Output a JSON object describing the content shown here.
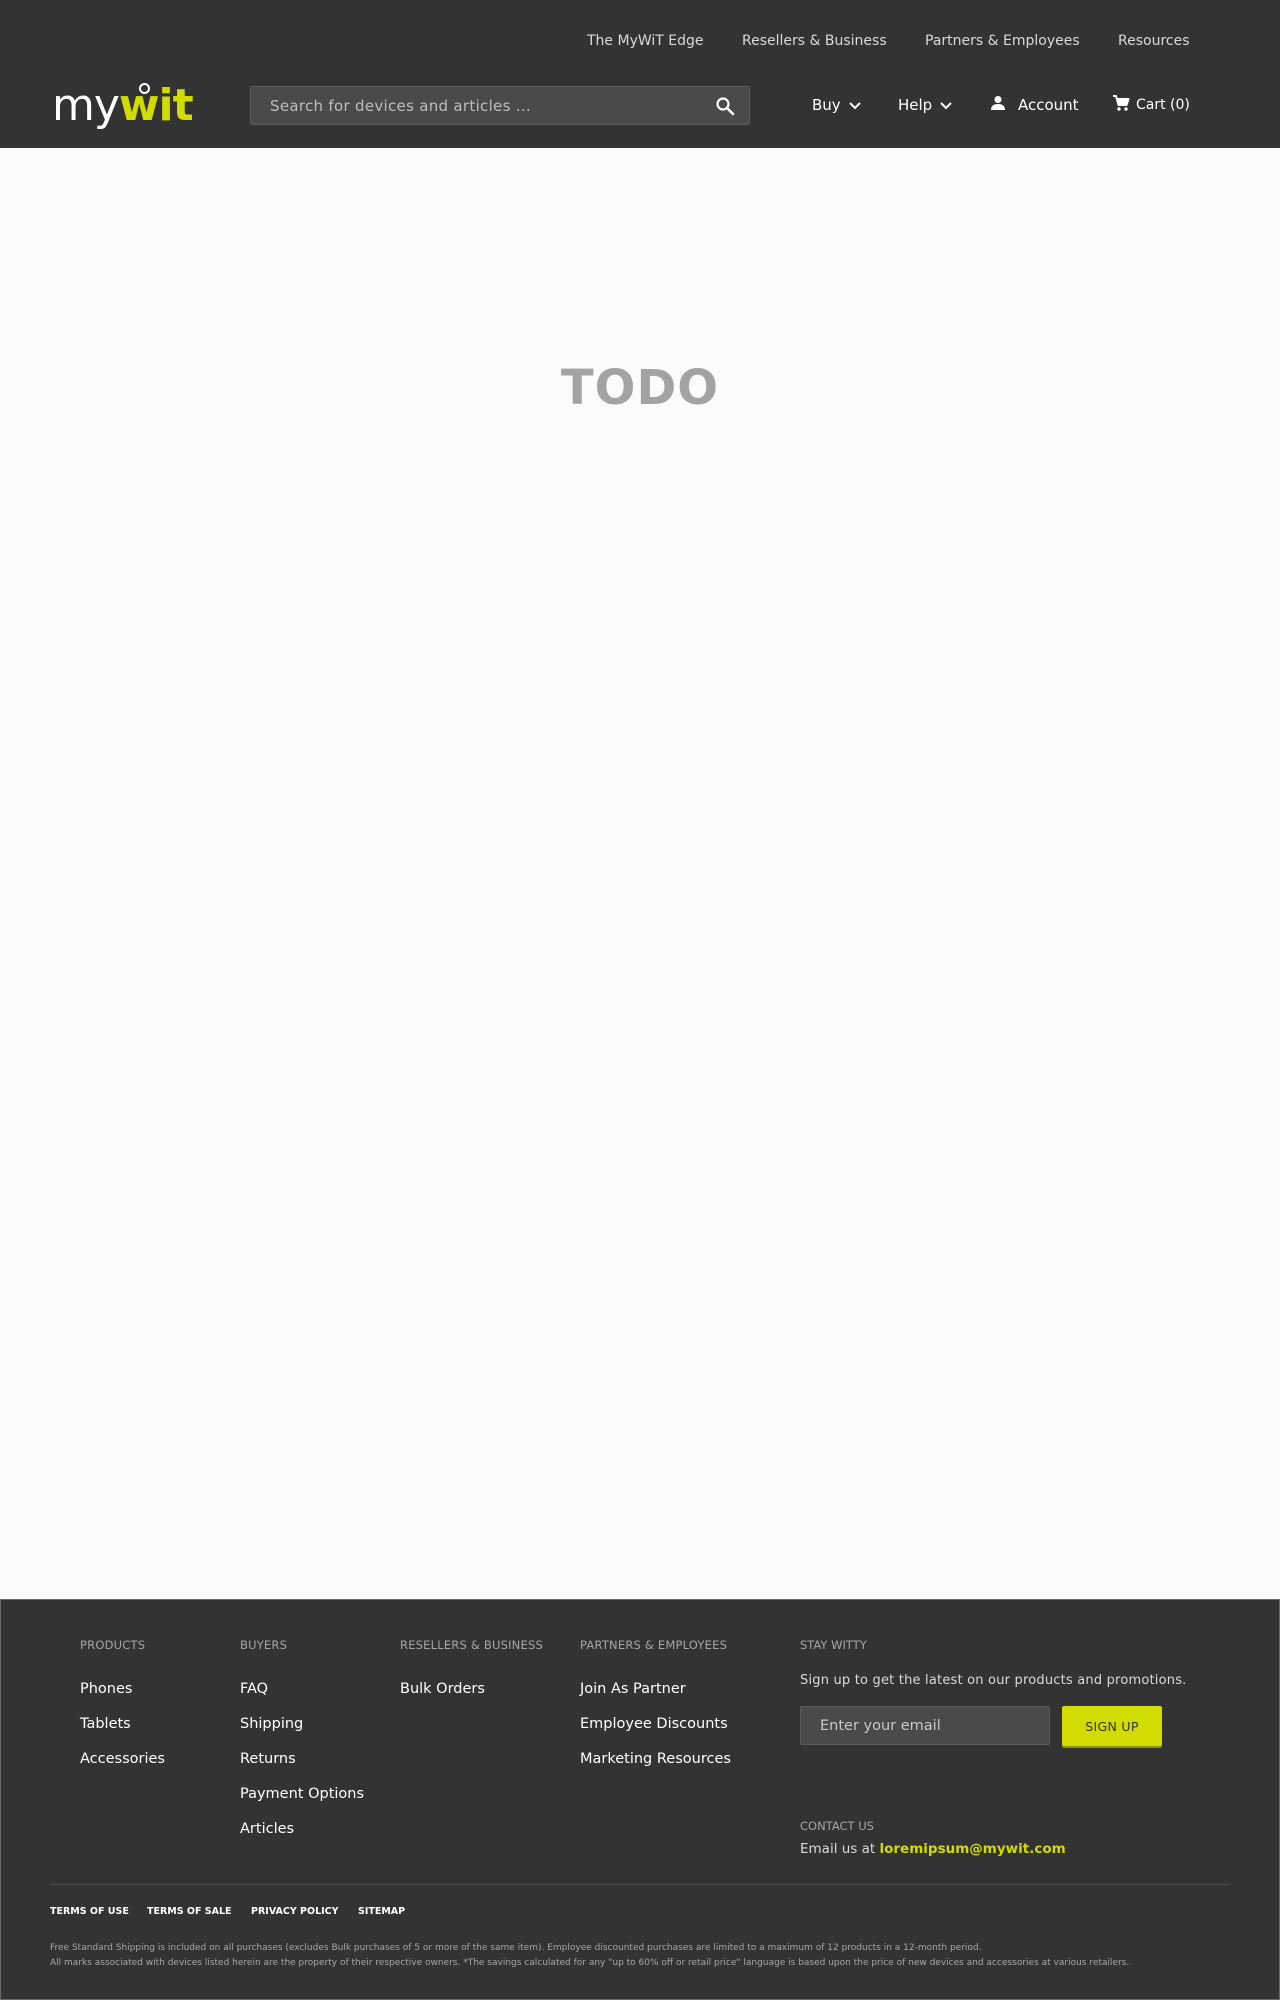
{
  "topnav": {
    "items": [
      {
        "label": "The MyWiT Edge"
      },
      {
        "label": "Resellers & Business"
      },
      {
        "label": "Partners & Employees"
      },
      {
        "label": "Resources"
      }
    ]
  },
  "logo": {
    "part1": "my",
    "part2": "wit"
  },
  "search": {
    "placeholder": "Search for devices and articles …",
    "value": ""
  },
  "mainnav": {
    "buy": "Buy",
    "help": "Help",
    "account": "Account",
    "cart": "Cart (0)"
  },
  "main": {
    "placeholder": "TODO"
  },
  "footer": {
    "columns": [
      {
        "heading": "PRODUCTS",
        "links": [
          "Phones",
          "Tablets",
          "Accessories"
        ]
      },
      {
        "heading": "BUYERS",
        "links": [
          "FAQ",
          "Shipping",
          "Returns",
          "Payment Options",
          "Articles"
        ]
      },
      {
        "heading": "RESELLERS & BUSINESS",
        "links": [
          "Bulk Orders"
        ]
      },
      {
        "heading": "PARTNERS & EMPLOYEES",
        "links": [
          "Join As Partner",
          "Employee Discounts",
          "Marketing Resources"
        ]
      }
    ],
    "stay_witty": {
      "heading": "STAY WITTY",
      "text": "Sign up to get the latest on our products and promotions.",
      "email_placeholder": "Enter your email",
      "signup_label": "SIGN UP"
    },
    "contact": {
      "heading": "CONTACT US",
      "prefix": "Email us at",
      "email": "loremipsum@mywit.com"
    },
    "legal_links": [
      "TERMS OF USE",
      "TERMS OF SALE",
      "PRIVACY POLICY",
      "SITEMAP"
    ],
    "disclaimer": [
      "Free Standard Shipping is included on all purchases (excludes Bulk purchases of 5 or more of the same item). Employee discounted purchases are limited to a maximum of 12 products in a 12-month period.",
      "All marks associated with devices listed herein are the property of their respective owners. *The savings calculated for any \"up to 60% off or retail price\" language is based upon the price of new devices and accessories at various retailers."
    ]
  },
  "colors": {
    "accent": "#d1dc00",
    "header_bg": "#333333",
    "page_bg": "#fbfbfb"
  },
  "icons": [
    "search-icon",
    "chevron-down-icon",
    "user-icon",
    "cart-icon"
  ]
}
